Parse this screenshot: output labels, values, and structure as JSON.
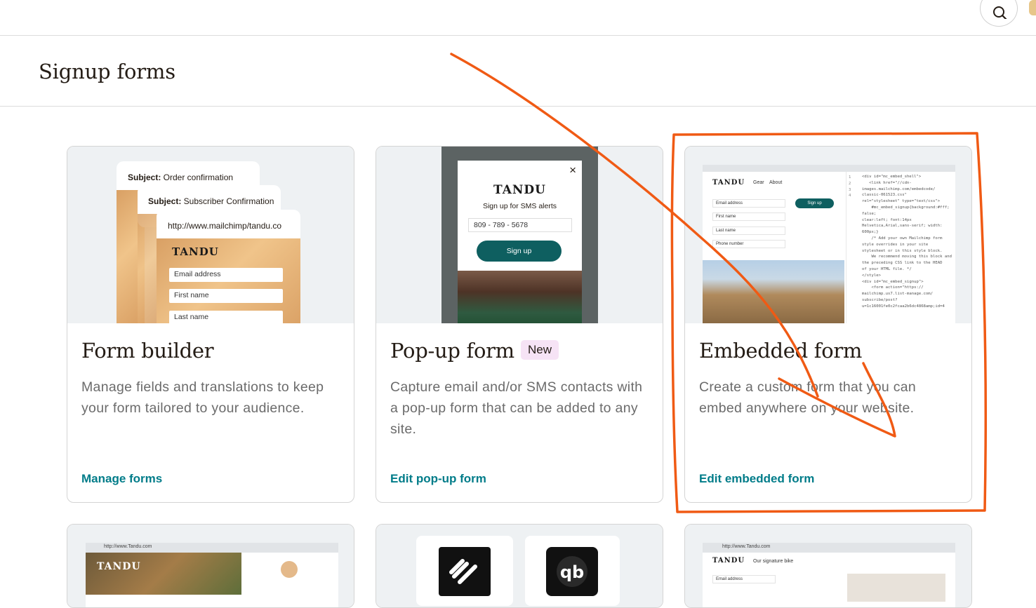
{
  "header": {
    "title": "Signup forms"
  },
  "cards": [
    {
      "title": "Form builder",
      "description": "Manage fields and translations to keep your form tailored to your audience.",
      "link": "Manage forms",
      "preview": {
        "subject1_label": "Subject:",
        "subject1_value": " Order confirmation",
        "subject2_label": "Subject:",
        "subject2_value": " Subscriber Confirmation",
        "url": "http://www.mailchimp/tandu.co",
        "brand": "TANDU",
        "fields": [
          "Email address",
          "First name",
          "Last name"
        ]
      }
    },
    {
      "title": "Pop-up form",
      "badge": "New",
      "description": "Capture email and/or SMS contacts with a pop-up form that can be added to any site.",
      "link": "Edit pop-up form",
      "preview": {
        "brand": "TANDU",
        "subtitle": "Sign up for SMS alerts",
        "phone": "809 - 789 - 5678",
        "button": "Sign up",
        "close": "×"
      }
    },
    {
      "title": "Embedded form",
      "description": "Create a custom form that you can embed anywhere on your website.",
      "link": "Edit embedded form",
      "preview": {
        "brand": "TANDU",
        "nav": [
          "Gear",
          "About"
        ],
        "fields": [
          "Email address",
          "First name",
          "Last name",
          "Phone number"
        ],
        "button": "Sign up",
        "line_numbers": "1\n2\n3\n4",
        "code": "<div id=\"mc_embed_shell\">\n   <link href=\"//cdn-\nimages.mailchimp.com/embedcode/\nclassic-061523.css\"\nrel=\"stylesheet\" type=\"text/css\">\n    #mc_embed_signup{background:#fff;\nfalse;\nclear:left; font:14px\nHelvetica,Arial,sans-serif; width:\n600px;}\n    /* Add your own Mailchimp form\nstyle overrides in your site\nstylesheet or in this style block.\n    We recommend moving this block and\nthe preceding CSS link to the HEAD\nof your HTML file. */\n</style>\n<div id=\"mc_embed_signup\">\n    <form action=\"https://\nmailchimp.us7.list-manage.com/\nsubscribe/post?\nu=1c16001fe0c2fcaa2b6dc4868amp;id=4"
      }
    }
  ],
  "bottom_cards": [
    {
      "url": "http://www.Tandu.com",
      "brand": "TANDU"
    },
    {
      "icons": [
        "squarespace-icon",
        "quickbooks-icon"
      ]
    },
    {
      "url": "http://www.Tandu.com",
      "brand": "TANDU",
      "tagline": "Our signature bike",
      "field": "Email address"
    }
  ],
  "colors": {
    "accent_link": "#007c89",
    "annotation": "#f05a14",
    "badge_bg": "#f6e3f5",
    "popup_button": "#0e5f60"
  }
}
